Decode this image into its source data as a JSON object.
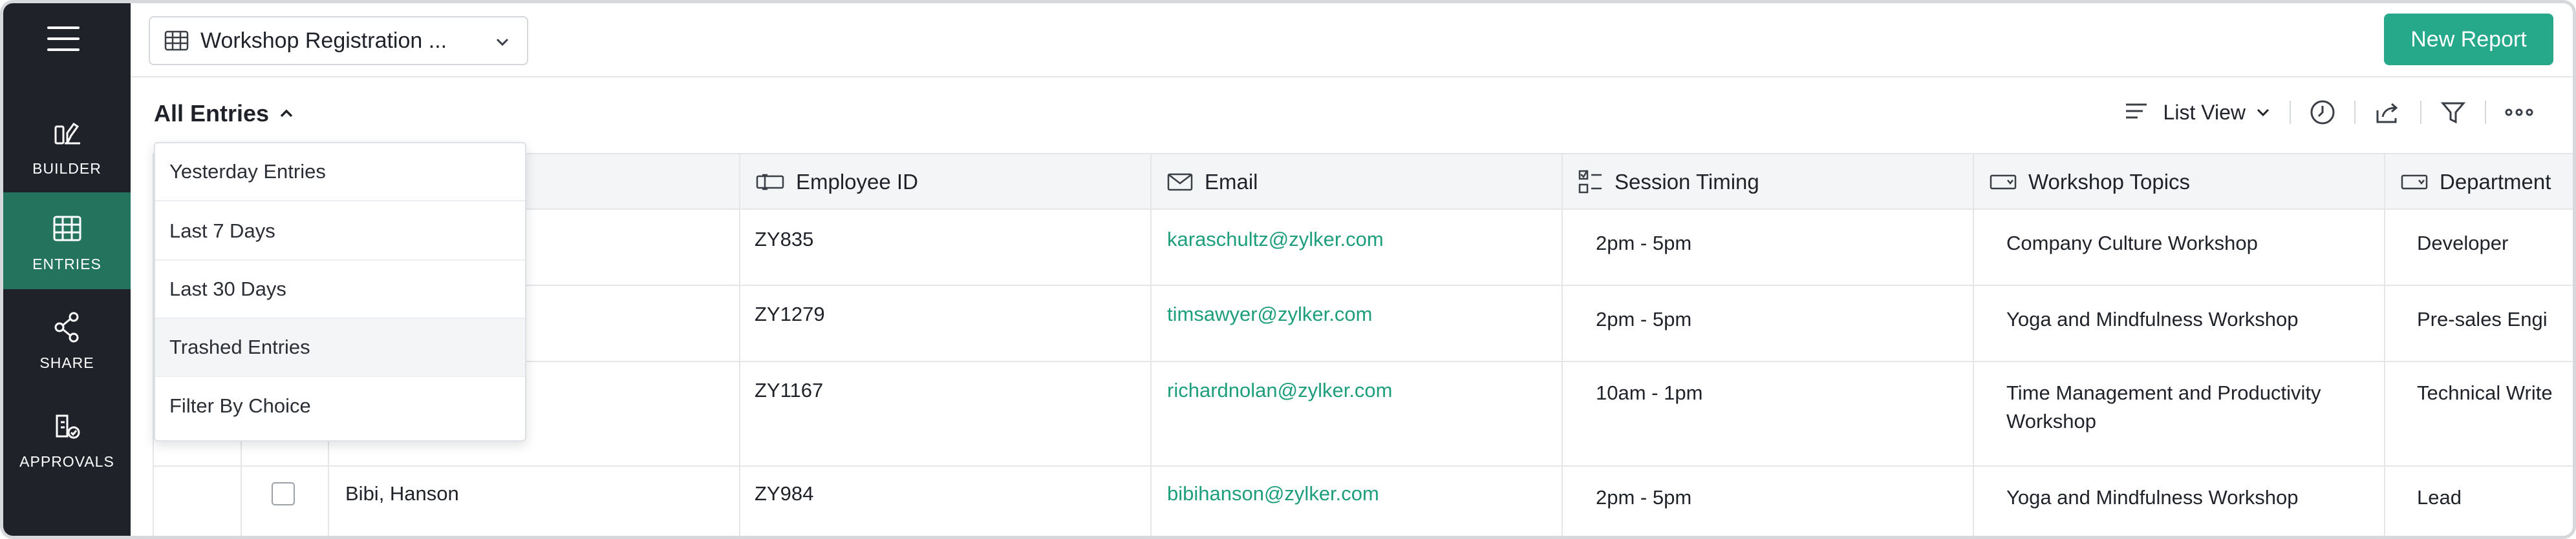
{
  "sidebar": {
    "items": [
      {
        "label": "BUILDER",
        "icon": "builder-icon"
      },
      {
        "label": "ENTRIES",
        "icon": "entries-grid-icon",
        "active": true
      },
      {
        "label": "SHARE",
        "icon": "share-icon"
      },
      {
        "label": "APPROVALS",
        "icon": "approvals-icon"
      }
    ]
  },
  "header": {
    "form_name": "Workshop Registration ...",
    "new_report_label": "New Report",
    "accent_color": "#26a98b"
  },
  "toolbar": {
    "entries_filter_label": "All Entries",
    "view_label": "List View"
  },
  "dropdown": {
    "items": [
      "Yesterday Entries",
      "Last 7 Days",
      "Last 30 Days",
      "Trashed Entries",
      "Filter By Choice"
    ]
  },
  "table": {
    "columns": [
      "Employee ID",
      "Email",
      "Session Timing",
      "Workshop Topics",
      "Department"
    ],
    "rows": [
      {
        "name": "",
        "employee_id": "ZY835",
        "email": "karaschultz@zylker.com",
        "session": "2pm - 5pm",
        "topic": "Company Culture Workshop",
        "department": "Developer"
      },
      {
        "name": "",
        "employee_id": "ZY1279",
        "email": "timsawyer@zylker.com",
        "session": "2pm - 5pm",
        "topic": "Yoga and Mindfulness Workshop",
        "department": "Pre-sales Engi"
      },
      {
        "name": "",
        "employee_id": "ZY1167",
        "email": "richardnolan@zylker.com",
        "session": "10am - 1pm",
        "topic": "Time Management and Productivity Workshop",
        "department": "Technical Write"
      },
      {
        "name": "Bibi, Hanson",
        "employee_id": "ZY984",
        "email": "bibihanson@zylker.com",
        "session": "2pm - 5pm",
        "topic": "Yoga and Mindfulness Workshop",
        "department": "Lead"
      }
    ]
  }
}
